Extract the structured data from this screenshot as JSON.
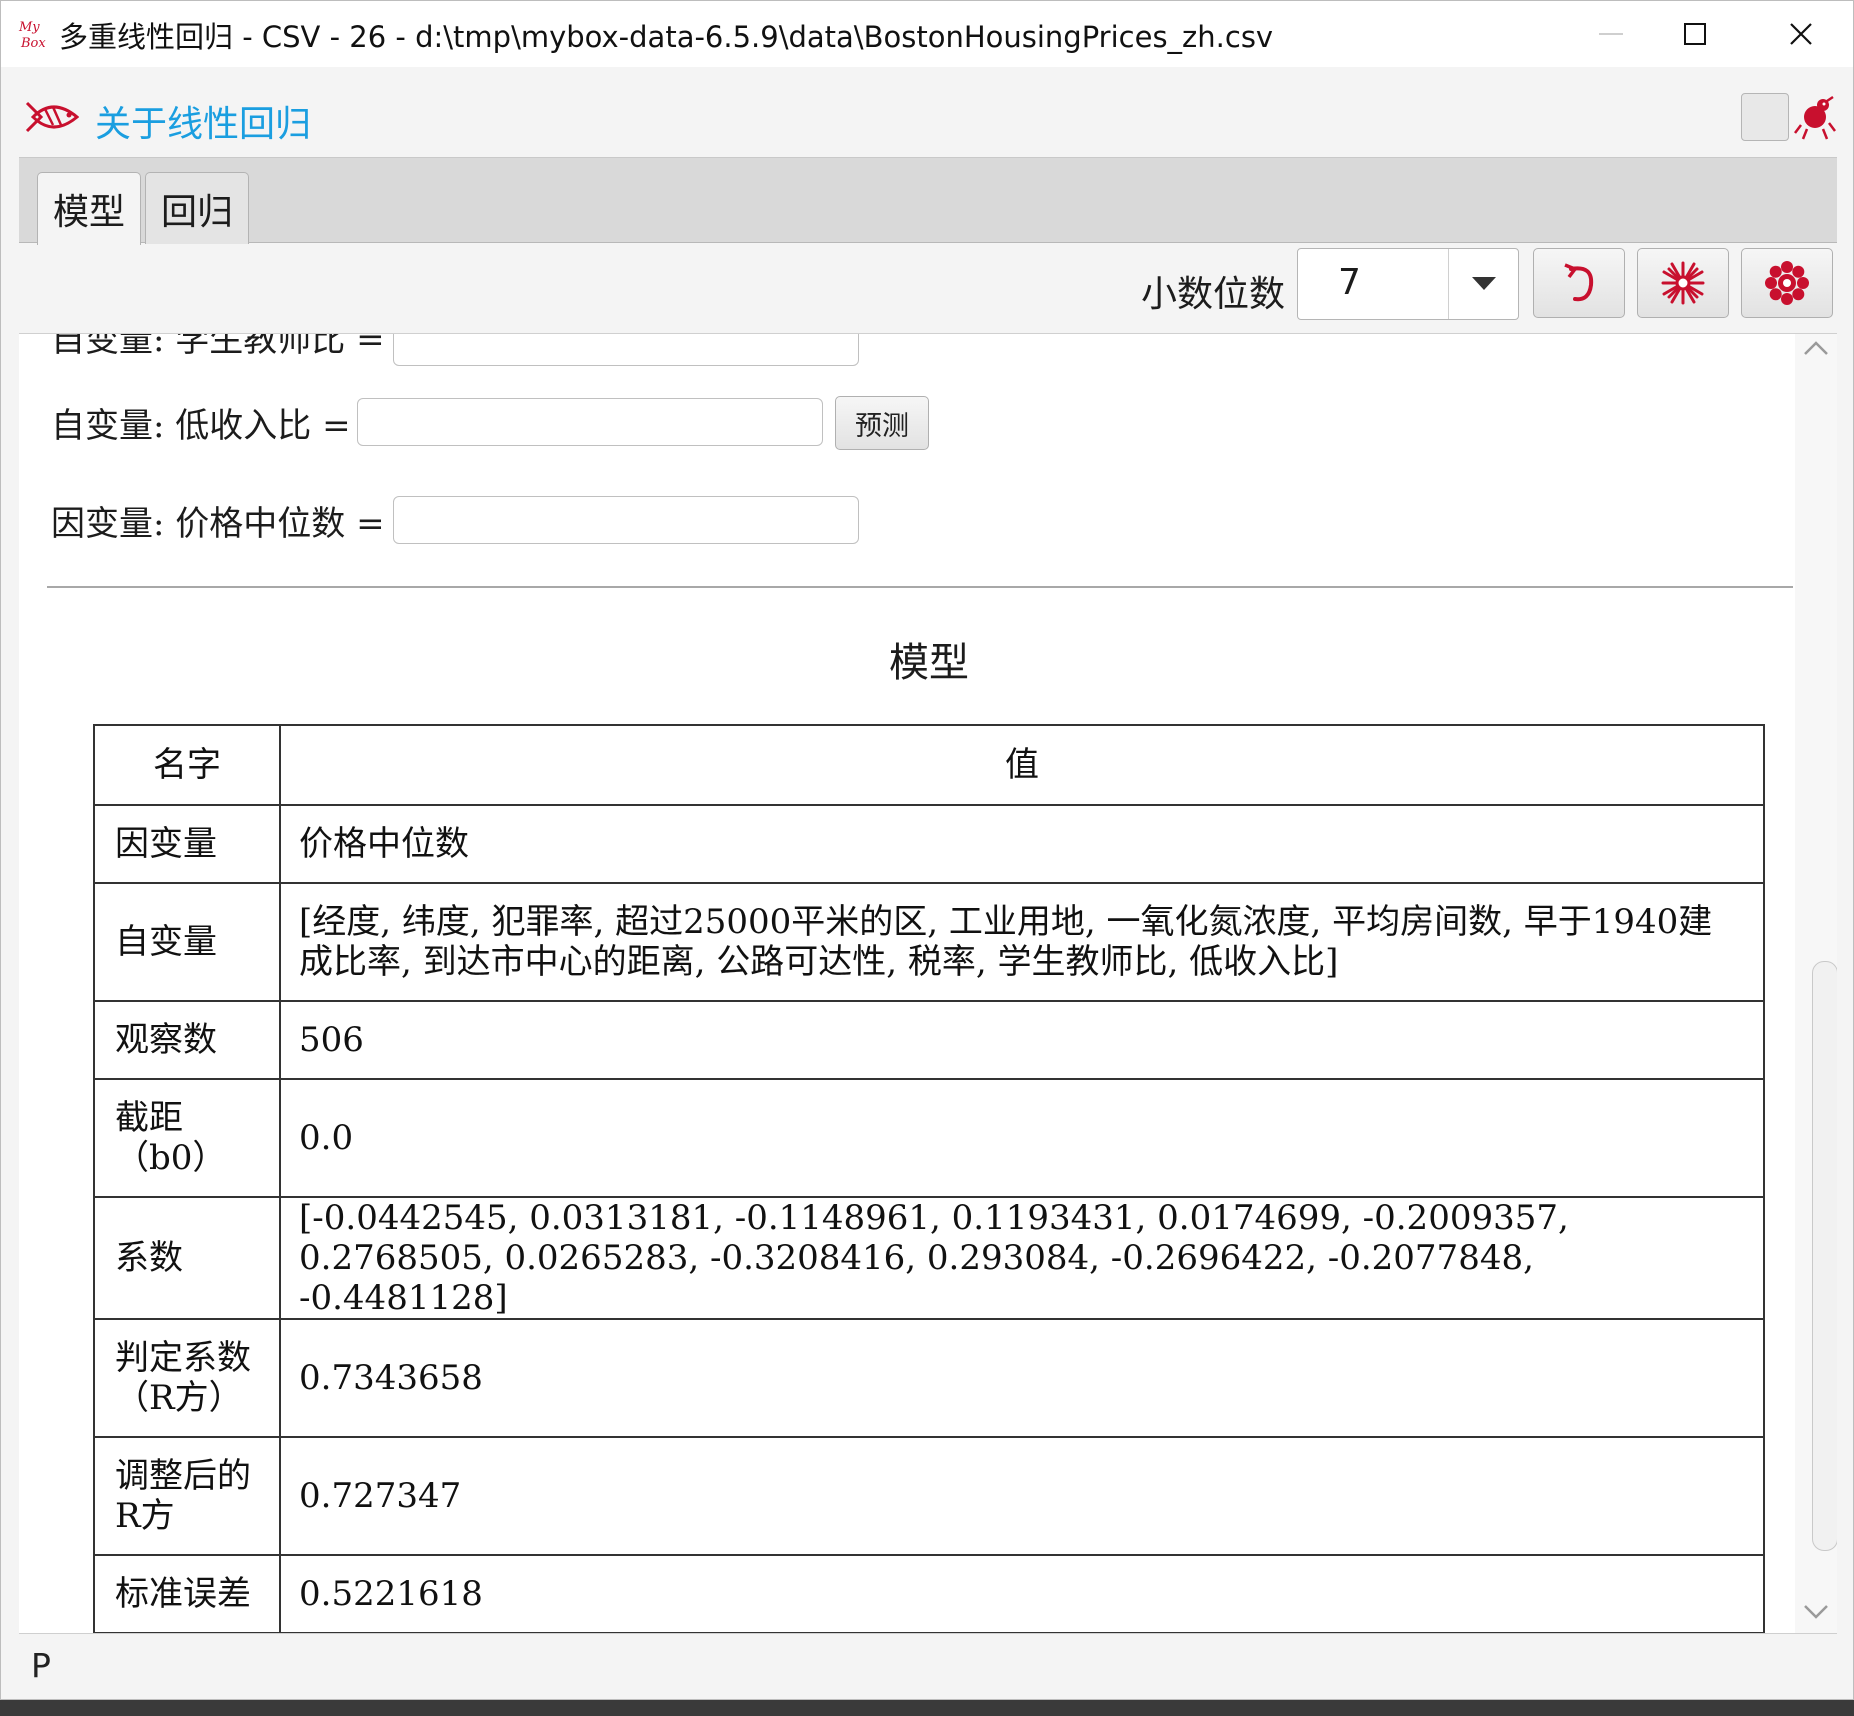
{
  "window": {
    "title": "多重线性回归 - CSV - 26 - d:\\tmp\\mybox-data-6.5.9\\data\\BostonHousingPrices_zh.csv",
    "app_icon_text": "My Box",
    "controls": [
      "minimize",
      "maximize",
      "close"
    ]
  },
  "header": {
    "about_label": "关于线性回归"
  },
  "tabs": [
    {
      "label": "模型",
      "active": true
    },
    {
      "label": "回归",
      "active": false
    }
  ],
  "toolbar": {
    "decimal_label": "小数位数",
    "decimal_value": "7",
    "buttons": [
      "refresh-icon",
      "snowflake-icon",
      "flower-icon"
    ]
  },
  "form": {
    "partial_label": "自变量: 学生教师比 =",
    "low_income_label": "自变量: 低收入比 =",
    "predict_label": "预测",
    "dependent_label": "因变量: 价格中位数 ="
  },
  "model": {
    "title": "模型",
    "headers": {
      "name": "名字",
      "value": "值"
    },
    "rows": [
      {
        "name": "因变量",
        "value": "价格中位数"
      },
      {
        "name": "自变量",
        "value": "[经度, 纬度, 犯罪率, 超过25000平米的区, 工业用地, 一氧化氮浓度, 平均房间数, 早于1940建成比率, 到达市中心的距离, 公路可达性, 税率, 学生教师比, 低收入比]"
      },
      {
        "name": "观察数",
        "value": "506"
      },
      {
        "name": "截距（b0）",
        "value": "0.0"
      },
      {
        "name": "系数",
        "value": "[-0.0442545, 0.0313181, -0.1148961, 0.1193431, 0.0174699, -0.2009357, 0.2768505, 0.0265283, -0.3208416, 0.293084, -0.2696422, -0.2077848, -0.4481128]"
      },
      {
        "name": "判定系数（R方）",
        "value": "0.7343658"
      },
      {
        "name": "调整后的R方",
        "value": "0.727347"
      },
      {
        "name": "标准误差",
        "value": "0.5221618"
      }
    ]
  },
  "status": {
    "text": "P"
  },
  "colors": {
    "accent_link": "#1a9ee0",
    "icon_red": "#c8102e"
  }
}
